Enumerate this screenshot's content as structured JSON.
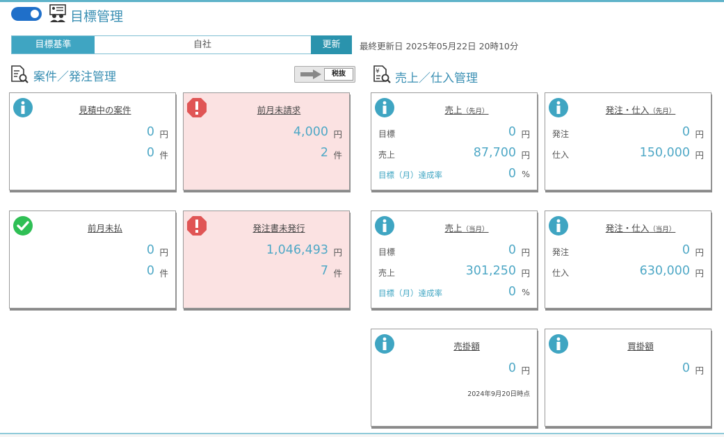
{
  "header": {
    "title": "目標管理"
  },
  "filter": {
    "label": "目標基準",
    "value": "自社",
    "update_label": "更新",
    "last_updated": "最終更新日 2025年05月22日 20時10分"
  },
  "sections": {
    "left_title": "案件／発注管理",
    "right_title": "売上／仕入管理",
    "tax_label": "税抜"
  },
  "cards": {
    "estimating": {
      "title": "見積中の案件",
      "amount": "0",
      "amount_unit": "円",
      "count": "0",
      "count_unit": "件",
      "status": "info"
    },
    "unbilled": {
      "title": "前月未請求",
      "amount": "4,000",
      "amount_unit": "円",
      "count": "2",
      "count_unit": "件",
      "status": "alert"
    },
    "unpaid": {
      "title": "前月未払",
      "amount": "0",
      "amount_unit": "円",
      "count": "0",
      "count_unit": "件",
      "status": "ok"
    },
    "po_unissued": {
      "title": "発注書未発行",
      "amount": "1,046,493",
      "amount_unit": "円",
      "count": "7",
      "count_unit": "件",
      "status": "alert"
    },
    "sales_prev": {
      "title": "売上",
      "period": "（先月）",
      "target_label": "目標",
      "target": "0",
      "sales_label": "売上",
      "sales": "87,700",
      "rate_label": "目標（月）達成率",
      "rate": "0",
      "unit": "円",
      "pct": "%"
    },
    "purchase_prev": {
      "title": "発注・仕入",
      "period": "（先月）",
      "order_label": "発注",
      "order": "0",
      "purchase_label": "仕入",
      "purchase": "150,000",
      "unit": "円"
    },
    "sales_cur": {
      "title": "売上",
      "period": "（当月）",
      "target_label": "目標",
      "target": "0",
      "sales_label": "売上",
      "sales": "301,250",
      "rate_label": "目標（月）達成率",
      "rate": "0",
      "unit": "円",
      "pct": "%"
    },
    "purchase_cur": {
      "title": "発注・仕入",
      "period": "（当月）",
      "order_label": "発注",
      "order": "0",
      "purchase_label": "仕入",
      "purchase": "630,000",
      "unit": "円"
    },
    "receivable": {
      "title": "売掛額",
      "amount": "0",
      "unit": "円",
      "note": "2024年9月20日時点"
    },
    "payable": {
      "title": "買掛額",
      "amount": "0",
      "unit": "円"
    }
  },
  "colors": {
    "accent": "#3fa5c2",
    "title": "#3a8fb3",
    "alert_bg": "#fbe2e2",
    "alert_icon": "#e05555",
    "ok_icon": "#2fbf55",
    "toggle": "#1f6fc9"
  }
}
